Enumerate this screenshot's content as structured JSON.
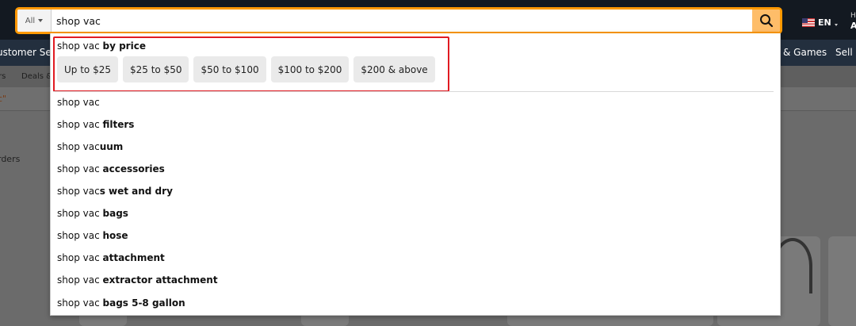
{
  "search": {
    "category": "All",
    "query": "shop vac"
  },
  "header": {
    "language": "EN",
    "account_greeting": "H",
    "account_label": "A"
  },
  "navbar": {
    "left_item": "ustomer Serv",
    "games_item": "& Games",
    "sell_item": "Sell"
  },
  "subnav": {
    "item_1": "rs",
    "item_2": "Deals &"
  },
  "page": {
    "results_query": "c\"",
    "orders_label": "rders"
  },
  "dropdown": {
    "price_heading": {
      "prefix": "shop vac ",
      "suffix": "by price"
    },
    "price_chips": [
      "Up to $25",
      "$25 to $50",
      "$50 to $100",
      "$100 to $200",
      "$200 & above"
    ],
    "suggestions": [
      {
        "prefix": "shop vac",
        "suffix": ""
      },
      {
        "prefix": "shop vac ",
        "suffix": "filters"
      },
      {
        "prefix": "shop vac",
        "suffix": "uum"
      },
      {
        "prefix": "shop vac ",
        "suffix": "accessories"
      },
      {
        "prefix": "shop vac",
        "suffix": "s wet and dry"
      },
      {
        "prefix": "shop vac ",
        "suffix": "bags"
      },
      {
        "prefix": "shop vac ",
        "suffix": "hose"
      },
      {
        "prefix": "shop vac ",
        "suffix": "attachment"
      },
      {
        "prefix": "shop vac ",
        "suffix": "extractor attachment"
      },
      {
        "prefix": "shop vac ",
        "suffix": "bags 5-8 gallon"
      }
    ]
  },
  "colors": {
    "highlight_border": "#e11b22",
    "search_focus": "#ff9900",
    "search_button": "#febd69"
  }
}
